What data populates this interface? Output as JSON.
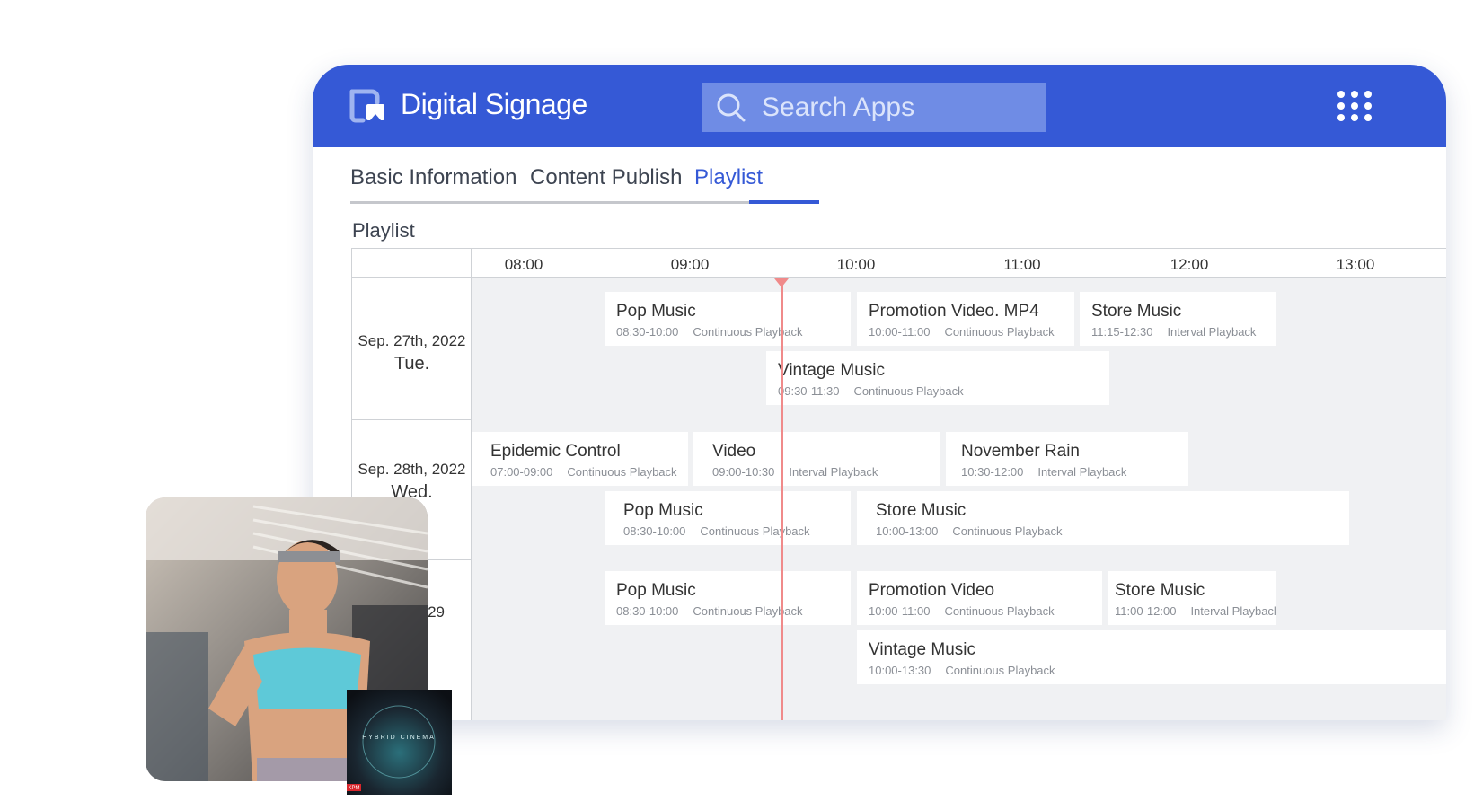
{
  "app": {
    "title": "Digital Signage",
    "brand_color": "#3559d6"
  },
  "search": {
    "placeholder": "Search Apps"
  },
  "icons": {
    "logo": "signage-logo-icon",
    "search": "search-icon",
    "apps": "grid-dots-icon"
  },
  "tabs": [
    {
      "label": "Basic Information",
      "active": false
    },
    {
      "label": "Content Publish",
      "active": false
    },
    {
      "label": "Playlist",
      "active": true
    }
  ],
  "section_title": "Playlist",
  "timeline": {
    "ticks": [
      "08:00",
      "09:00",
      "10:00",
      "11:00",
      "12:00",
      "13:00"
    ],
    "now_indicator_color": "#f08a8a"
  },
  "rows": [
    {
      "date": "Sep. 27th, 2022",
      "day": "Tue."
    },
    {
      "date": "Sep. 28th, 2022",
      "day": "Wed."
    },
    {
      "date": "29",
      "day": ""
    }
  ],
  "items": [
    {
      "title": "Pop Music",
      "time": "08:30-10:00",
      "mode": "Continuous Playback"
    },
    {
      "title": "Promotion Video. MP4",
      "time": "10:00-11:00",
      "mode": "Continuous Playback"
    },
    {
      "title": "Store Music",
      "time": "11:15-12:30",
      "mode": "Interval Playback"
    },
    {
      "title": "Vintage Music",
      "time": "09:30-11:30",
      "mode": "Continuous Playback"
    },
    {
      "title": "Epidemic Control",
      "time": "07:00-09:00",
      "mode": "Continuous Playback"
    },
    {
      "title": "Video",
      "time": "09:00-10:30",
      "mode": "Interval Playback"
    },
    {
      "title": "November Rain",
      "time": "10:30-12:00",
      "mode": "Interval Playback"
    },
    {
      "title": "Pop Music",
      "time": "08:30-10:00",
      "mode": "Continuous Playback"
    },
    {
      "title": "Store Music",
      "time": "10:00-13:00",
      "mode": "Continuous Playback"
    },
    {
      "title": "Pop Music",
      "time": "08:30-10:00",
      "mode": "Continuous Playback"
    },
    {
      "title": "Promotion Video",
      "time": "10:00-11:00",
      "mode": "Continuous Playback"
    },
    {
      "title": "Store Music",
      "time": "11:00-12:00",
      "mode": "Interval Playback"
    },
    {
      "title": "Vintage Music",
      "time": "10:00-13:30",
      "mode": "Continuous Playback"
    }
  ],
  "album": {
    "title": "HYBRID CINEMA",
    "label": "KPM"
  }
}
